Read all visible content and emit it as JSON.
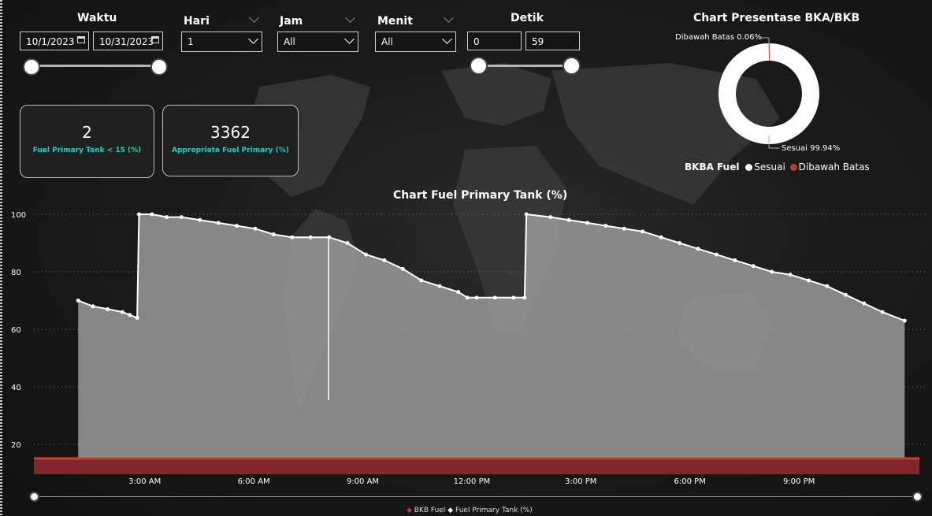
{
  "filters": {
    "waktu": {
      "label": "Waktu",
      "start": "10/1/2023",
      "end": "10/31/2023"
    },
    "hari": {
      "label": "Hari",
      "value": "1"
    },
    "jam": {
      "label": "Jam",
      "value": "All"
    },
    "menit": {
      "label": "Menit",
      "value": "All"
    },
    "detik": {
      "label": "Detik",
      "min": "0",
      "max": "59"
    }
  },
  "kpis": [
    {
      "value": "2",
      "caption": "Fuel Primary Tank < 15 (%)"
    },
    {
      "value": "3362",
      "caption": "Appropriate Fuel Primary (%)"
    }
  ],
  "colors": {
    "sesuai": "#ffffff",
    "dibawah": "#c0392b",
    "accent": "#1fd1c0",
    "bkb_band": "#8e2a2f"
  },
  "donut": {
    "title": "Chart Presentase BKA/BKB",
    "label_top": "Dibawah Batas 0.06%",
    "label_bottom": "Sesuai 99.94%",
    "legend_title": "BKBA Fuel",
    "legend_items": [
      "Sesuai",
      "Dibawah Batas"
    ]
  },
  "chart_data": [
    {
      "type": "pie",
      "title": "Chart Presentase BKA/BKB",
      "categories": [
        "Sesuai",
        "Dibawah Batas"
      ],
      "values": [
        99.94,
        0.06
      ],
      "legend_title": "BKBA Fuel"
    },
    {
      "type": "area",
      "title": "Chart Fuel Primary Tank (%)",
      "x_ticks": [
        "3:00 AM",
        "6:00 AM",
        "9:00 AM",
        "12:00 PM",
        "3:00 PM",
        "6:00 PM",
        "9:00 PM"
      ],
      "y_ticks": [
        "20",
        "40",
        "60",
        "80",
        "100"
      ],
      "ylim": [
        15,
        103
      ],
      "xlim_hours": [
        0,
        24
      ],
      "grid": true,
      "legend": [
        "BKB Fuel",
        "Fuel Primary Tank (%)"
      ],
      "series": [
        {
          "name": "Fuel Primary Tank (%)",
          "x_hours": [
            1.2,
            1.6,
            2.0,
            2.4,
            2.6,
            2.8,
            2.85,
            3.2,
            3.6,
            4.0,
            4.5,
            5.0,
            5.5,
            6.0,
            6.5,
            7.0,
            7.5,
            8.0,
            8.5,
            9.0,
            9.5,
            10.0,
            10.5,
            11.0,
            11.5,
            11.75,
            12.0,
            12.5,
            13.0,
            13.3,
            13.35,
            14.0,
            14.5,
            15.0,
            15.5,
            16.0,
            16.5,
            17.0,
            17.5,
            18.0,
            18.5,
            19.0,
            19.5,
            20.0,
            20.5,
            21.0,
            21.5,
            22.0,
            22.5,
            23.0,
            23.6
          ],
          "values": [
            70,
            68,
            67,
            66,
            65,
            64,
            100,
            100,
            99,
            99,
            98,
            97,
            96,
            95,
            93,
            92,
            92,
            92,
            90,
            86,
            84,
            81,
            77,
            75,
            73,
            71,
            71,
            71,
            71,
            71,
            100,
            99,
            98,
            97,
            96,
            95,
            94,
            92,
            90,
            88,
            86,
            84,
            82,
            80,
            79,
            77,
            75,
            72,
            69,
            66,
            63
          ]
        },
        {
          "name": "BKB Fuel",
          "x_hours": [
            0,
            24
          ],
          "values": [
            15,
            15
          ]
        }
      ]
    }
  ]
}
